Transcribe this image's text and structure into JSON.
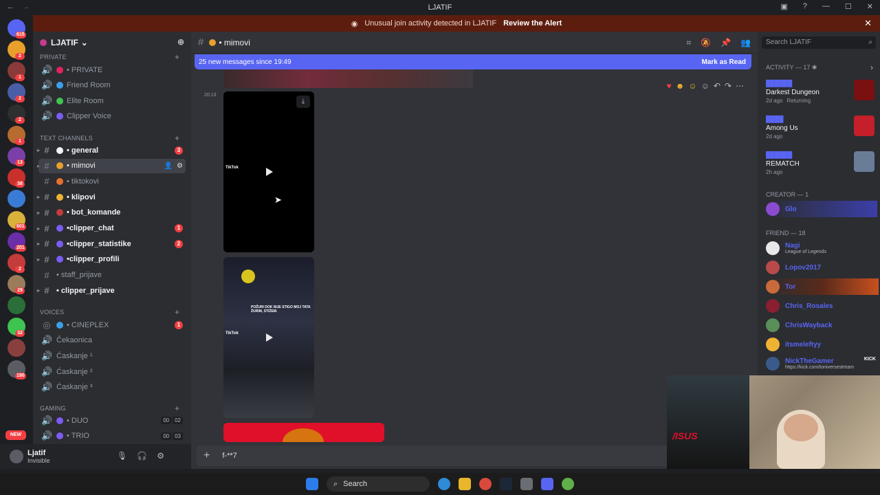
{
  "window": {
    "title": "LJATIF"
  },
  "alert": {
    "text": "Unusual join activity detected in LJATIF",
    "action": "Review the Alert"
  },
  "guild_badges": [
    "615",
    "2",
    "1",
    "2",
    "2",
    "1",
    "13",
    "38",
    "601",
    "201",
    "2",
    "29",
    "32",
    "190",
    "NEW"
  ],
  "server": {
    "name": "LJATIF"
  },
  "categories": {
    "private": "PRIVATE",
    "text": "Text Channels",
    "voices": "VOICES",
    "gaming": "GAMING"
  },
  "private_channels": [
    "• PRIVATE",
    "Friend Room",
    "Elite Room",
    "Clipper Voice"
  ],
  "text_channels": [
    {
      "name": "• general",
      "badge": "3"
    },
    {
      "name": "• mimovi",
      "badge": ""
    },
    {
      "name": "• tiktokovi",
      "badge": ""
    },
    {
      "name": "• klipovi",
      "badge": ""
    },
    {
      "name": "• bot_komande",
      "badge": ""
    },
    {
      "name": "•clipper_chat",
      "badge": "1"
    },
    {
      "name": "•clipper_statistike",
      "badge": "2"
    },
    {
      "name": "•clipper_profili",
      "badge": ""
    },
    {
      "name": "• staff_prijave",
      "badge": ""
    },
    {
      "name": "• clipper_prijave",
      "badge": ""
    }
  ],
  "voice_channels": [
    {
      "name": "• CINEPLEX",
      "badge": "1"
    },
    {
      "name": "Čekaonica",
      "badge": ""
    },
    {
      "name": "Ćaskanje ¹",
      "badge": ""
    },
    {
      "name": "Ćaskanje ²",
      "badge": ""
    },
    {
      "name": "Ćaskanje ³",
      "badge": ""
    }
  ],
  "gaming_channels": [
    {
      "name": "• DUO",
      "c1": "00",
      "c2": "02"
    },
    {
      "name": "• TRIO",
      "c1": "00",
      "c2": "03"
    }
  ],
  "user": {
    "name": "Ljatif",
    "status": "Invisible"
  },
  "channel": {
    "name": "• mimovi"
  },
  "new_messages": {
    "text": "25 new messages since 19:49",
    "action": "Mark as Read"
  },
  "message": {
    "time": "20:13"
  },
  "video_labels": {
    "tiktok": "TikTok",
    "caption": "POŽURI DOK NIJE STIGO MOJ TATA ŽURIM, STIŽEM."
  },
  "composer": {
    "text": "f-**7"
  },
  "search": {
    "placeholder": "Search LJATIF"
  },
  "activity": {
    "header": "Activity — 17",
    "items": [
      {
        "user": "██████",
        "game": "Darkest Dungeon",
        "time": "2d ago",
        "extra": "Returning"
      },
      {
        "user": "████",
        "game": "Among Us",
        "time": "2d ago",
        "extra": ""
      },
      {
        "user": "██████",
        "game": "REMATCH",
        "time": "2h ago",
        "extra": ""
      }
    ]
  },
  "creator": {
    "header": "CREATOR — 1",
    "members": [
      "Glo"
    ]
  },
  "friends": {
    "header": "FRIEND — 18",
    "members": [
      {
        "name": "Nagi",
        "status": "League of Legends"
      },
      {
        "name": "Lopov2017",
        "status": ""
      },
      {
        "name": "Tor",
        "status": ""
      },
      {
        "name": "Chris_Rosales",
        "status": ""
      },
      {
        "name": "ChrisWayback",
        "status": ""
      },
      {
        "name": "itsmeleftyy",
        "status": ""
      },
      {
        "name": "NickTheGamer",
        "status": "https://kick.com/toniversestream",
        "tag": "KICK"
      }
    ]
  },
  "taskbar": {
    "search": "Search"
  }
}
